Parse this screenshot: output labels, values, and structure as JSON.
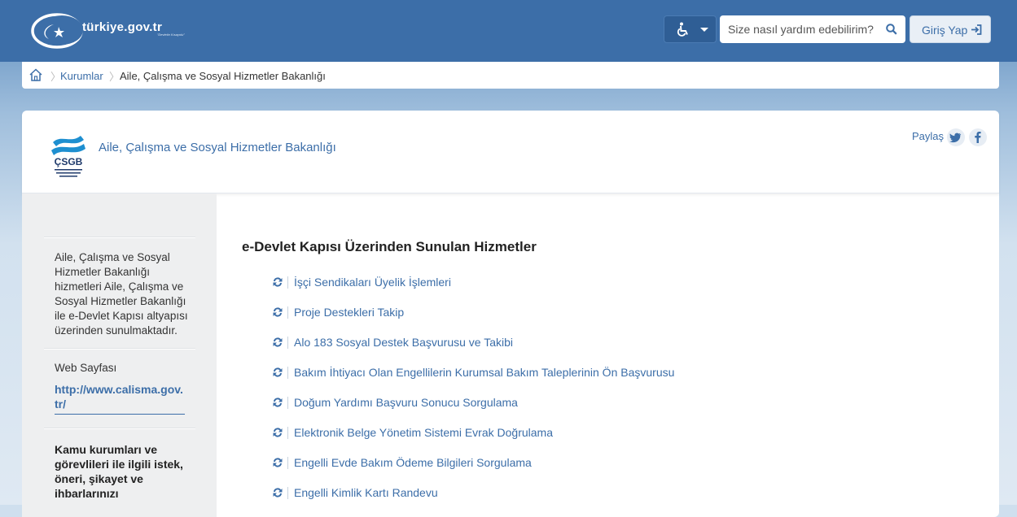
{
  "header": {
    "logo_text": "türkiye.gov.tr",
    "logo_tagline": "\"Devletin Kısayolu\"",
    "accessibility_icon": "wheelchair-icon",
    "search_placeholder": "Size nasıl yardım edebilirim?",
    "search_icon": "search-icon",
    "login_label": "Giriş Yap",
    "login_icon": "sign-in-icon",
    "header_color": "#3c6ea8"
  },
  "breadcrumb": {
    "home_icon": "home-icon",
    "items": [
      "Kurumlar",
      "Aile, Çalışma ve Sosyal Hizmetler Bakanlığı"
    ]
  },
  "institution": {
    "logo_text": "ÇSGB",
    "logo_subtext": "T.C. ÇALIŞMA VE SOSYAL GÜVENLİK BAKANLIĞI",
    "name": "Aile, Çalışma ve Sosyal Hizmetler Bakanlığı",
    "share_label": "Paylaş",
    "share_icons": [
      "twitter-icon",
      "facebook-icon"
    ]
  },
  "sidebar": {
    "description": "Aile, Çalışma ve Sosyal Hizmetler Bakanlığı hizmetleri Aile, Çalışma ve Sosyal Hizmetler Bakanlığı ile e-Devlet Kapısı altyapısı üzerinden sunulmaktadır.",
    "web_label": "Web Sayfası",
    "web_url": "http://www.calisma.gov.tr/",
    "complaint_text": "Kamu kurumları ve görevlileri ile ilgili istek, öneri, şikayet ve ihbarlarınızı"
  },
  "main": {
    "title": "e-Devlet Kapısı Üzerinden Sunulan Hizmetler",
    "service_icon": "refresh-icon",
    "services": [
      "İşçi Sendikaları Üyelik İşlemleri",
      "Proje Destekleri Takip",
      "Alo 183 Sosyal Destek Başvurusu ve Takibi",
      "Bakım İhtiyacı Olan Engellilerin Kurumsal Bakım Taleplerinin Ön Başvurusu",
      "Doğum Yardımı Başvuru Sonucu Sorgulama",
      "Elektronik Belge Yönetim Sistemi Evrak Doğrulama",
      "Engelli Evde Bakım Ödeme Bilgileri Sorgulama",
      "Engelli Kimlik Kartı Randevu"
    ]
  }
}
